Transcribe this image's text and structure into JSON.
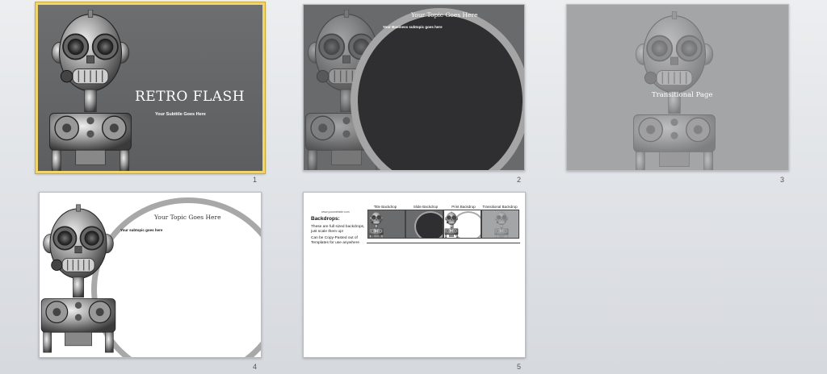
{
  "slides": [
    {
      "number": "1",
      "title": "RETRO FLASH",
      "subtitle": "Your Subtitle Goes Here",
      "selected": true
    },
    {
      "number": "2",
      "topic": "Your Topic Goes Here",
      "subtitle": "Your Business subtopic goes here"
    },
    {
      "number": "3",
      "title": "Transitional Page"
    },
    {
      "number": "4",
      "topic": "Your Topic Goes Here",
      "subtitle": "Your subtopic goes here"
    },
    {
      "number": "5",
      "header_small": "www.yourwebsite.com",
      "heading": "Backdrops:",
      "bullets": [
        "These are full sized backdrops, just scale them up!",
        "Can be Copy-Pasted out of Templates for use anywhere"
      ],
      "thumb_labels": [
        "Title Backdrop",
        "Slide Backdrop",
        "Print Backdrop",
        "Transitional Backdrop"
      ]
    }
  ],
  "colors": {
    "selection_border": "#f2d56a",
    "slide_gray": "#6a6b6d",
    "ellipse_dark": "#333333",
    "ring_gray": "#a3a3a3"
  }
}
